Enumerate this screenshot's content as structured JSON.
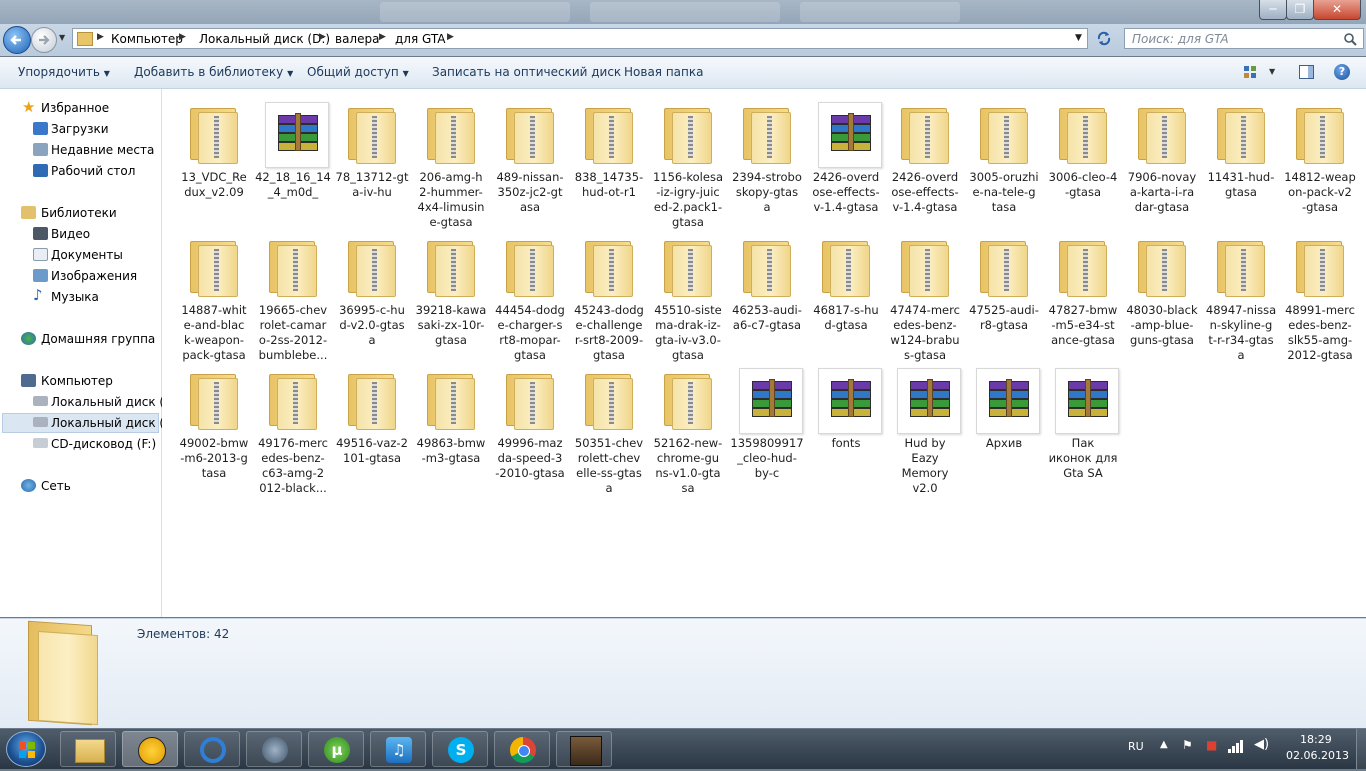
{
  "window": {
    "minimize_glyph": "─",
    "maximize_glyph": "❐",
    "close_glyph": "✕"
  },
  "address": {
    "crumbs": [
      "Компьютер",
      "Локальный диск (D:)",
      "валера",
      "для GTA"
    ],
    "search_placeholder": "Поиск: для GTA"
  },
  "commandbar": {
    "organize": "Упорядочить",
    "add_to_library": "Добавить в библиотеку",
    "share": "Общий доступ",
    "burn": "Записать на оптический диск",
    "new_folder": "Новая папка"
  },
  "nav": {
    "favorites": "Избранное",
    "downloads": "Загрузки",
    "recent": "Недавние места",
    "desktop": "Рабочий стол",
    "libraries": "Библиотеки",
    "video": "Видео",
    "documents": "Документы",
    "images": "Изображения",
    "music": "Музыка",
    "homegroup": "Домашняя группа",
    "computer": "Компьютер",
    "disk_c": "Локальный диск (C:",
    "disk_d": "Локальный диск (D:",
    "cd": "CD-дисковод (F:)",
    "network": "Сеть"
  },
  "files": [
    {
      "type": "zipfolder",
      "lines": [
        "13_VDC_Re",
        "dux_v2.09"
      ]
    },
    {
      "type": "rar",
      "lines": [
        "42_18_16_14",
        "_4_m0d_"
      ]
    },
    {
      "type": "zipfolder",
      "lines": [
        "78_13712-gt",
        "a-iv-hu"
      ]
    },
    {
      "type": "zipfolder",
      "lines": [
        "206-amg-h",
        "2-hummer-",
        "4x4-limusin",
        "e-gtasa"
      ]
    },
    {
      "type": "zipfolder",
      "lines": [
        "489-nissan-",
        "350z-jc2-gt",
        "asa"
      ]
    },
    {
      "type": "zipfolder",
      "lines": [
        "838_14735-",
        "hud-ot-r1"
      ]
    },
    {
      "type": "zipfolder",
      "lines": [
        "1156-kolesa",
        "-iz-igry-juic",
        "ed-2.pack1-",
        "gtasa"
      ]
    },
    {
      "type": "zipfolder",
      "lines": [
        "2394-strobo",
        "skopy-gtas",
        "a"
      ]
    },
    {
      "type": "rar",
      "lines": [
        "2426-overd",
        "ose-effects-",
        "v-1.4-gtasa"
      ]
    },
    {
      "type": "zipfolder",
      "lines": [
        "2426-overd",
        "ose-effects-",
        "v-1.4-gtasa"
      ]
    },
    {
      "type": "zipfolder",
      "lines": [
        "3005-oruzhi",
        "e-na-tele-g",
        "tasa"
      ]
    },
    {
      "type": "zipfolder",
      "lines": [
        "3006-cleo-4",
        "-gtasa"
      ]
    },
    {
      "type": "zipfolder",
      "lines": [
        "7906-novay",
        "a-karta-i-ra",
        "dar-gtasa"
      ]
    },
    {
      "type": "zipfolder",
      "lines": [
        "11431-hud-",
        "gtasa"
      ]
    },
    {
      "type": "zipfolder",
      "lines": [
        "14812-weap",
        "on-pack-v2",
        "-gtasa"
      ]
    },
    {
      "type": "zipfolder",
      "lines": [
        "14887-whit",
        "e-and-blac",
        "k-weapon-",
        "pack-gtasa"
      ]
    },
    {
      "type": "zipfolder",
      "lines": [
        "19665-chev",
        "rolet-camar",
        "o-2ss-2012-",
        "bumblebe..."
      ]
    },
    {
      "type": "zipfolder",
      "lines": [
        "36995-c-hu",
        "d-v2.0-gtas",
        "a"
      ]
    },
    {
      "type": "zipfolder",
      "lines": [
        "39218-kawa",
        "saki-zx-10r-",
        "gtasa"
      ]
    },
    {
      "type": "zipfolder",
      "lines": [
        "44454-dodg",
        "e-charger-s",
        "rt8-mopar-",
        "gtasa"
      ]
    },
    {
      "type": "zipfolder",
      "lines": [
        "45243-dodg",
        "e-challenge",
        "r-srt8-2009-",
        "gtasa"
      ]
    },
    {
      "type": "zipfolder",
      "lines": [
        "45510-siste",
        "ma-drak-iz-",
        "gta-iv-v3.0-",
        "gtasa"
      ]
    },
    {
      "type": "zipfolder",
      "lines": [
        "46253-audi-",
        "a6-c7-gtasa"
      ]
    },
    {
      "type": "zipfolder",
      "lines": [
        "46817-s-hu",
        "d-gtasa"
      ]
    },
    {
      "type": "zipfolder",
      "lines": [
        "47474-merc",
        "edes-benz-",
        "w124-brabu",
        "s-gtasa"
      ]
    },
    {
      "type": "zipfolder",
      "lines": [
        "47525-audi-",
        "r8-gtasa"
      ]
    },
    {
      "type": "zipfolder",
      "lines": [
        "47827-bmw",
        "-m5-e34-st",
        "ance-gtasa"
      ]
    },
    {
      "type": "zipfolder",
      "lines": [
        "48030-black",
        "-amp-blue-",
        "guns-gtasa"
      ]
    },
    {
      "type": "zipfolder",
      "lines": [
        "48947-nissa",
        "n-skyline-g",
        "t-r-r34-gtas",
        "a"
      ]
    },
    {
      "type": "zipfolder",
      "lines": [
        "48991-merc",
        "edes-benz-",
        "slk55-amg-",
        "2012-gtasa"
      ]
    },
    {
      "type": "zipfolder",
      "lines": [
        "49002-bmw",
        "-m6-2013-g",
        "tasa"
      ]
    },
    {
      "type": "zipfolder",
      "lines": [
        "49176-merc",
        "edes-benz-",
        "c63-amg-2",
        "012-black..."
      ]
    },
    {
      "type": "zipfolder",
      "lines": [
        "49516-vaz-2",
        "101-gtasa"
      ]
    },
    {
      "type": "zipfolder",
      "lines": [
        "49863-bmw",
        "-m3-gtasa"
      ]
    },
    {
      "type": "zipfolder",
      "lines": [
        "49996-maz",
        "da-speed-3",
        "-2010-gtasa"
      ]
    },
    {
      "type": "zipfolder",
      "lines": [
        "50351-chev",
        "rolett-chev",
        "elle-ss-gtas",
        "a"
      ]
    },
    {
      "type": "zipfolder",
      "lines": [
        "52162-new-",
        "chrome-gu",
        "ns-v1.0-gta",
        "sa"
      ]
    },
    {
      "type": "rar",
      "lines": [
        "1359809917",
        "_cleo-hud-",
        "by-c"
      ]
    },
    {
      "type": "rar",
      "lines": [
        "fonts"
      ]
    },
    {
      "type": "rar",
      "lines": [
        "Hud by",
        "Eazy",
        "Memory",
        "v2.0"
      ]
    },
    {
      "type": "rar",
      "lines": [
        "Архив"
      ]
    },
    {
      "type": "rar",
      "lines": [
        "Пак",
        "иконок для",
        "Gta SA"
      ]
    }
  ],
  "details": {
    "count": "Элементов: 42"
  },
  "taskbar": {
    "lang": "RU",
    "time": "18:29",
    "date": "02.06.2013"
  }
}
